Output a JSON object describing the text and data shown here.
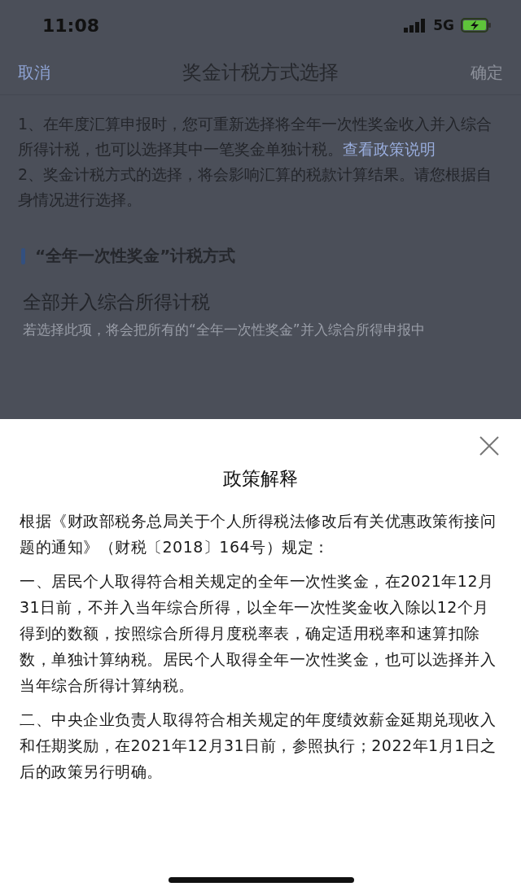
{
  "status_bar": {
    "time": "11:08",
    "network": "5G"
  },
  "nav_bar": {
    "cancel": "取消",
    "title": "奖金计税方式选择",
    "confirm": "确定",
    "confirm_disabled": true
  },
  "notes": [
    {
      "text": "1、在年度汇算申报时，您可重新选择将全年一次性奖金收入并入综合所得计税，也可以选择其中一笔奖金单独计税。",
      "link": "查看政策说明"
    },
    {
      "text": "2、奖金计税方式的选择，将会影响汇算的税款计算结果。请您根据自身情况进行选择。"
    }
  ],
  "section": {
    "title": "“全年一次性奖金”计税方式"
  },
  "options": [
    {
      "title": "全部并入综合所得计税",
      "description": "若选择此项，将会把所有的“全年一次性奖金”并入综合所得申报中"
    }
  ],
  "sheet": {
    "title": "政策解释",
    "paragraphs": [
      "根据《财政部税务总局关于个人所得税法修改后有关优惠政策衔接问题的通知》（财税〔2018〕164号）规定：",
      "一、居民个人取得符合相关规定的全年一次性奖金，在2021年12月31日前，不并入当年综合所得，以全年一次性奖金收入除以12个月得到的数额，按照综合所得月度税率表，确定适用税率和速算扣除数，单独计算纳税。居民个人取得全年一次性奖金，也可以选择并入当年综合所得计算纳税。",
      "二、中央企业负责人取得符合相关规定的年度绩效薪金延期兑现收入和任期奖励，在2021年12月31日前，参照执行；2022年1月1日之后的政策另行明确。"
    ]
  }
}
